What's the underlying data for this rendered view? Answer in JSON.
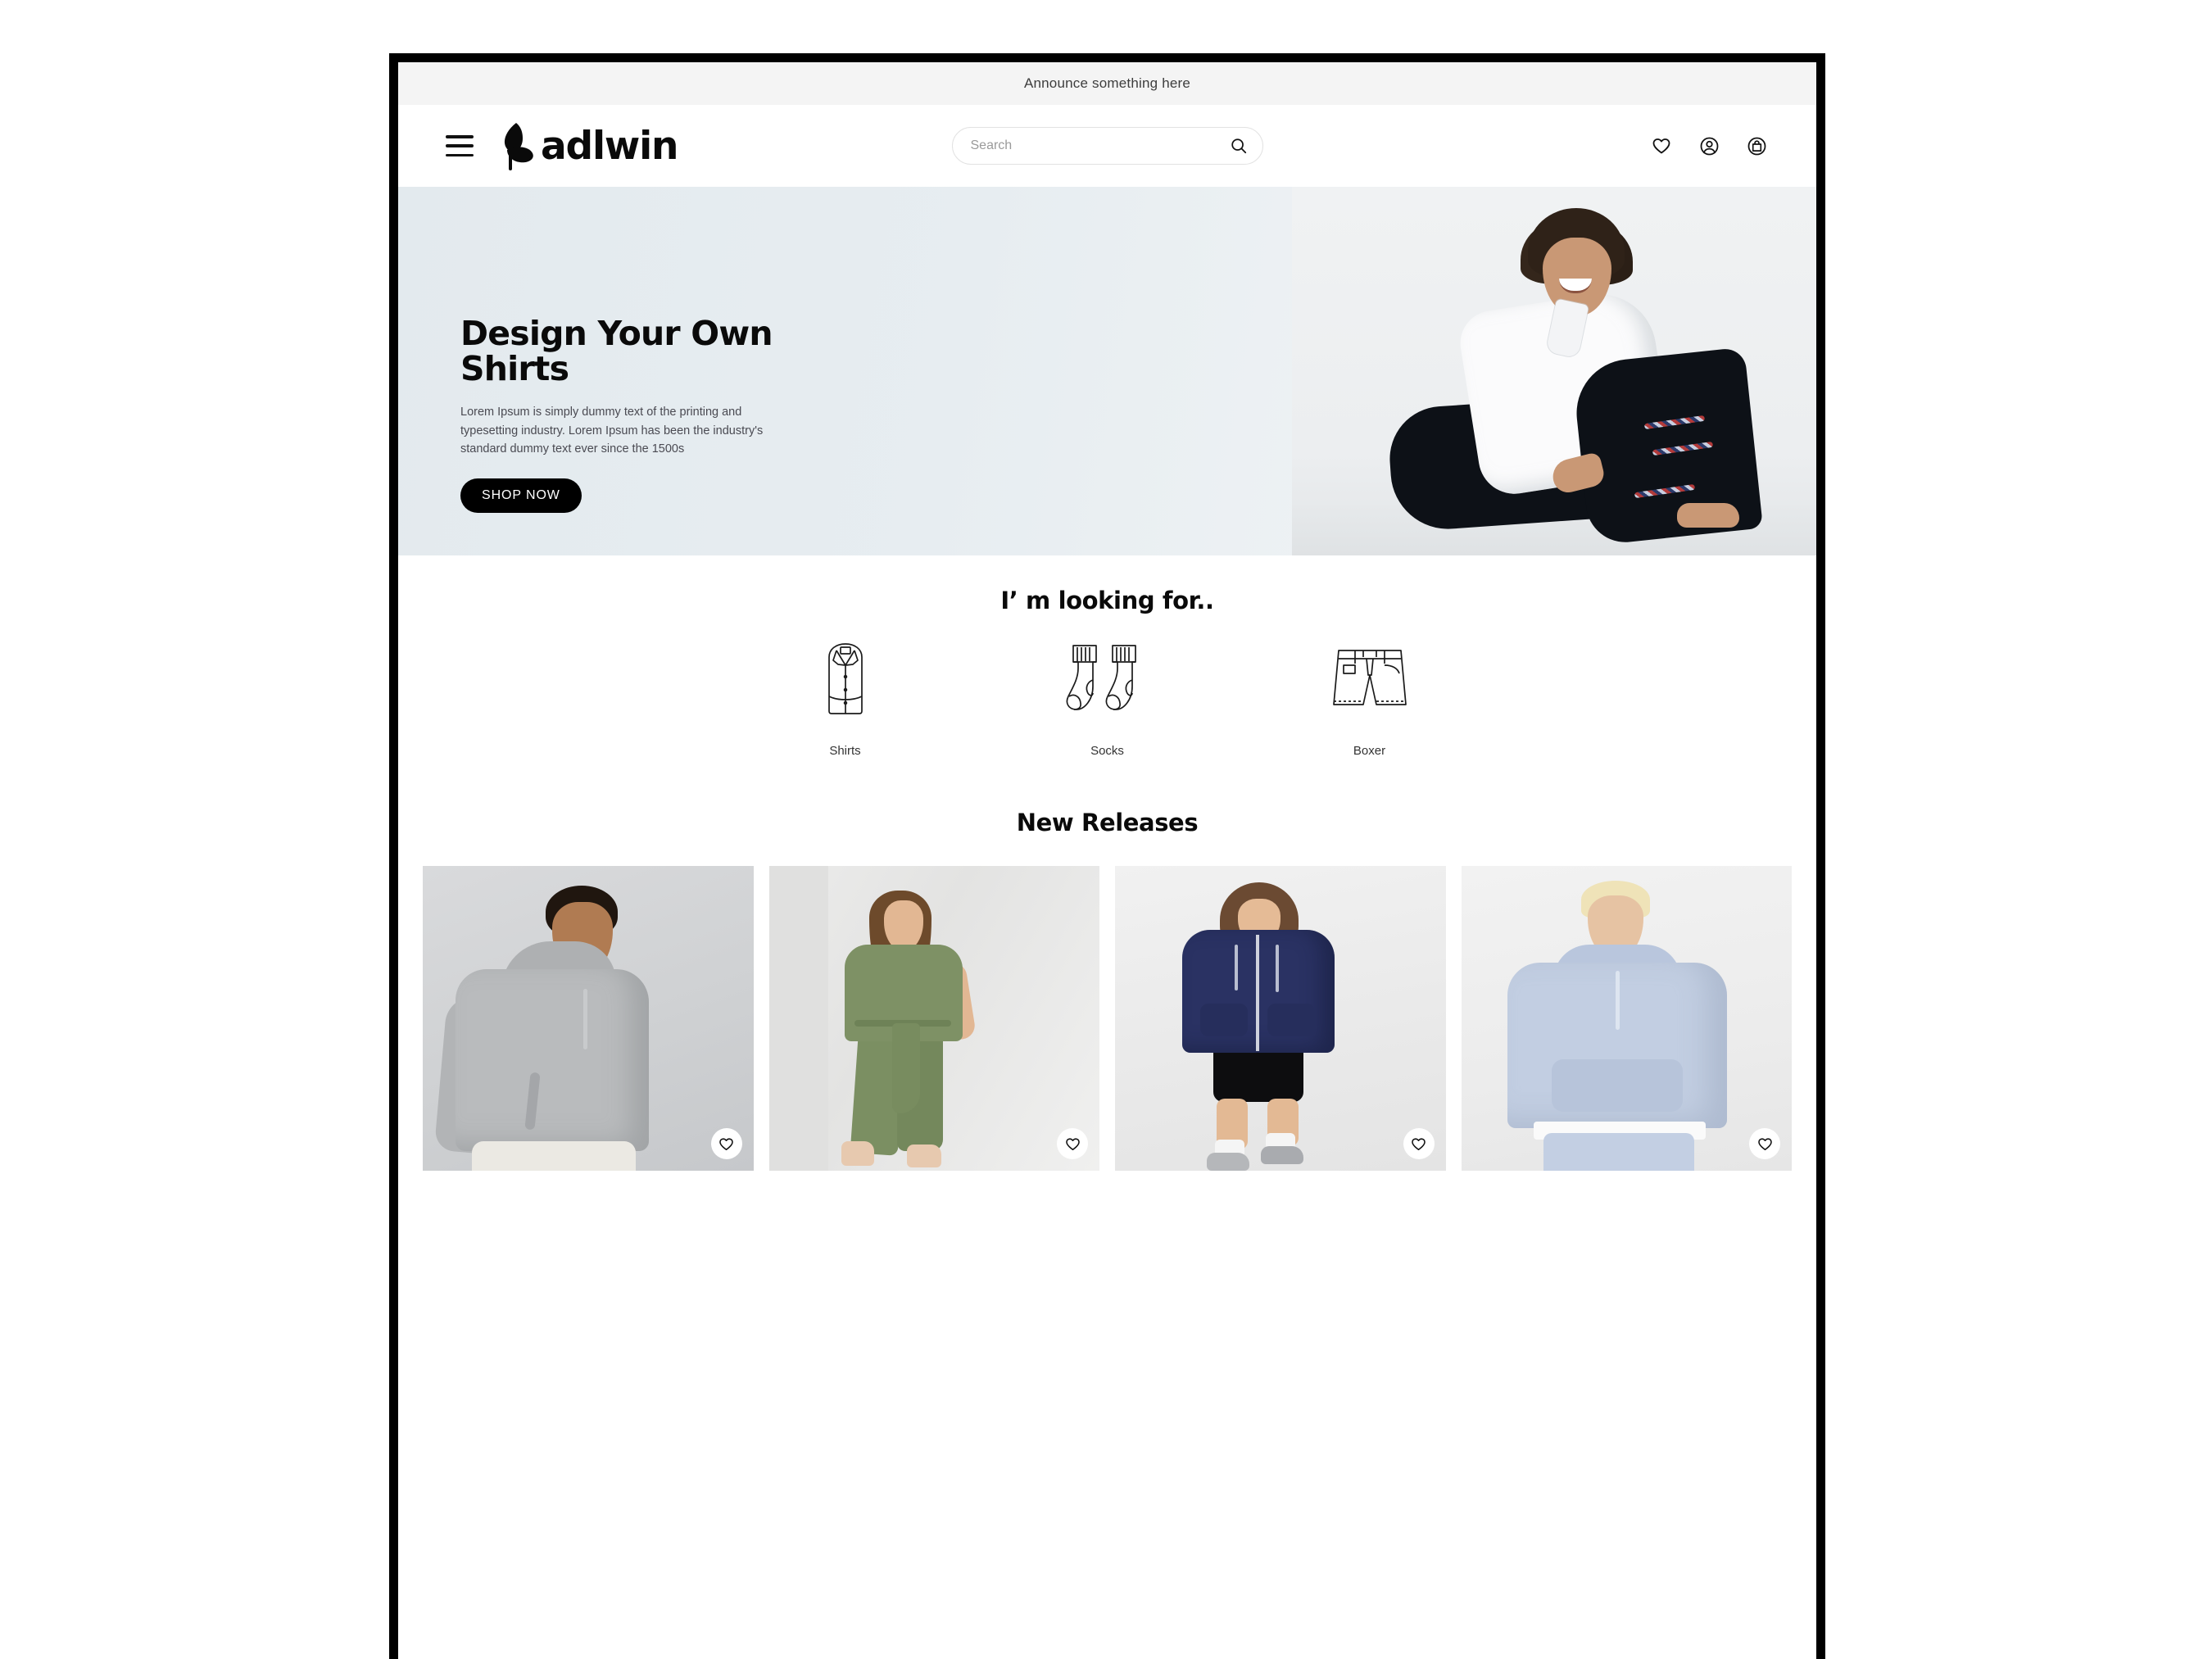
{
  "announcement": {
    "text": "Announce something here"
  },
  "header": {
    "menu_icon": "hamburger-menu-icon",
    "brand_name": "adlwin",
    "brand_mark": "leaf-logo-icon",
    "search": {
      "placeholder": "Search",
      "value": "",
      "icon": "search-icon"
    },
    "actions": [
      {
        "name": "wishlist",
        "icon": "heart-icon"
      },
      {
        "name": "account",
        "icon": "user-circle-icon"
      },
      {
        "name": "cart",
        "icon": "shopping-bag-icon"
      }
    ]
  },
  "hero": {
    "title": "Design Your Own Shirts",
    "subtitle": "Lorem Ipsum is simply dummy text of the printing and typesetting industry. Lorem Ipsum has been the industry's standard dummy text ever since the 1500s",
    "cta_label": "SHOP NOW",
    "background_color": "#e4eaee",
    "image_alt": "Smiling young man with curly hair in white shirt and black suit sitting on floor"
  },
  "categories": {
    "title": "I’ m looking for..",
    "items": [
      {
        "label": "Shirts",
        "icon": "folded-shirt-icon"
      },
      {
        "label": "Socks",
        "icon": "socks-pair-icon"
      },
      {
        "label": "Boxer",
        "icon": "shorts-icon"
      }
    ]
  },
  "new_releases": {
    "title": "New Releases",
    "products": [
      {
        "title": "",
        "price": "",
        "wishlist_icon": "heart-icon",
        "image_alt": "Man in grey pullover hoodie"
      },
      {
        "title": "",
        "price": "",
        "wishlist_icon": "heart-icon",
        "image_alt": "Woman in olive green belted jumpsuit with nude heels"
      },
      {
        "title": "",
        "price": "",
        "wishlist_icon": "heart-icon",
        "image_alt": "Woman in navy zip hoodie with black bike shorts and sneakers"
      },
      {
        "title": "",
        "price": "",
        "wishlist_icon": "heart-icon",
        "image_alt": "Blond man in light blue hoodie and matching sweatpants"
      }
    ]
  },
  "colors": {
    "accent": "#000000",
    "announce_bg": "#f4f4f4",
    "page_bg": "#ffffff",
    "frame": "#000000"
  }
}
